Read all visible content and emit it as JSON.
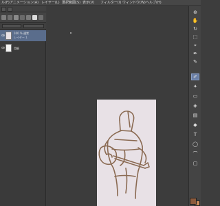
{
  "menubar": {
    "items": [
      {
        "label": "ル(F)"
      },
      {
        "label": "アニメーション(A)"
      },
      {
        "label": "レイヤー(L)"
      },
      {
        "label": "選択範囲(S)"
      },
      {
        "label": "表示(V)"
      },
      {
        "label": "フィルター(I)"
      },
      {
        "label": "ウィンドウ(W)"
      },
      {
        "label": "ヘルプ(H)"
      }
    ]
  },
  "layers": {
    "items": [
      {
        "name": "100 % 通常",
        "sub": "レイヤー 1",
        "selected": true
      },
      {
        "name": "用紙",
        "sub": "",
        "selected": false
      }
    ]
  },
  "toolbar": {
    "tools": [
      {
        "icon": "zoom-icon"
      },
      {
        "icon": "hand-icon"
      },
      {
        "icon": "rotate-icon"
      },
      {
        "icon": "select-icon"
      },
      {
        "icon": "eyedropper-icon"
      },
      {
        "icon": "pen-icon"
      },
      {
        "icon": "pencil-icon"
      },
      {
        "icon": "brush-icon"
      },
      {
        "icon": "airbrush-icon"
      },
      {
        "icon": "eraser-icon"
      },
      {
        "icon": "fill-icon"
      },
      {
        "icon": "gradient-icon"
      },
      {
        "icon": "shape-icon"
      },
      {
        "icon": "text-icon"
      },
      {
        "icon": "balloon-icon"
      },
      {
        "icon": "ruler-icon"
      },
      {
        "icon": "frame-icon"
      }
    ]
  },
  "colors": {
    "main": "#8c5a3c",
    "sub": "#c98a5a",
    "line": "#8a6a52",
    "paper": "#e8e1e6"
  }
}
